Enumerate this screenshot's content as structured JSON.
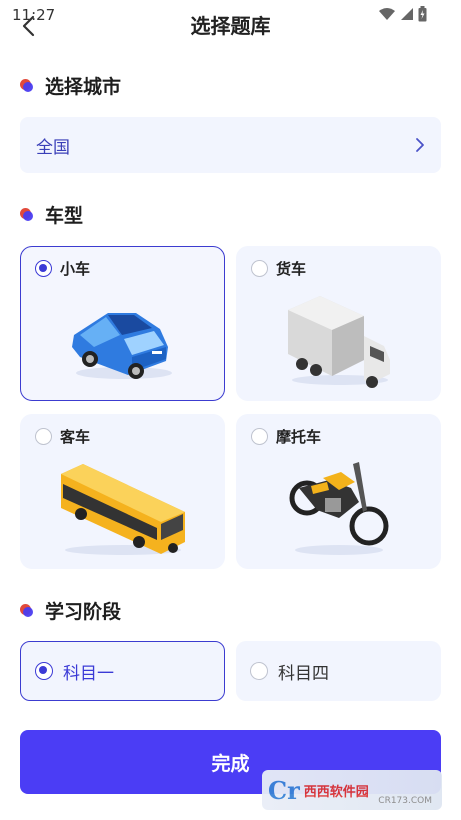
{
  "status": {
    "time": "11:27"
  },
  "header": {
    "title": "选择题库"
  },
  "city_section": {
    "title": "选择城市",
    "value": "全国"
  },
  "vehicle_section": {
    "title": "车型",
    "items": [
      {
        "label": "小车",
        "selected": true
      },
      {
        "label": "货车",
        "selected": false
      },
      {
        "label": "客车",
        "selected": false
      },
      {
        "label": "摩托车",
        "selected": false
      }
    ]
  },
  "stage_section": {
    "title": "学习阶段",
    "items": [
      {
        "label": "科目一",
        "selected": true
      },
      {
        "label": "科目四",
        "selected": false
      }
    ]
  },
  "footer": {
    "done_label": "完成"
  },
  "watermark": {
    "brand": "西西软件园",
    "site": "CR173.COM"
  },
  "colors": {
    "accent": "#4b3df5",
    "card_bg": "#f2f5fe"
  }
}
